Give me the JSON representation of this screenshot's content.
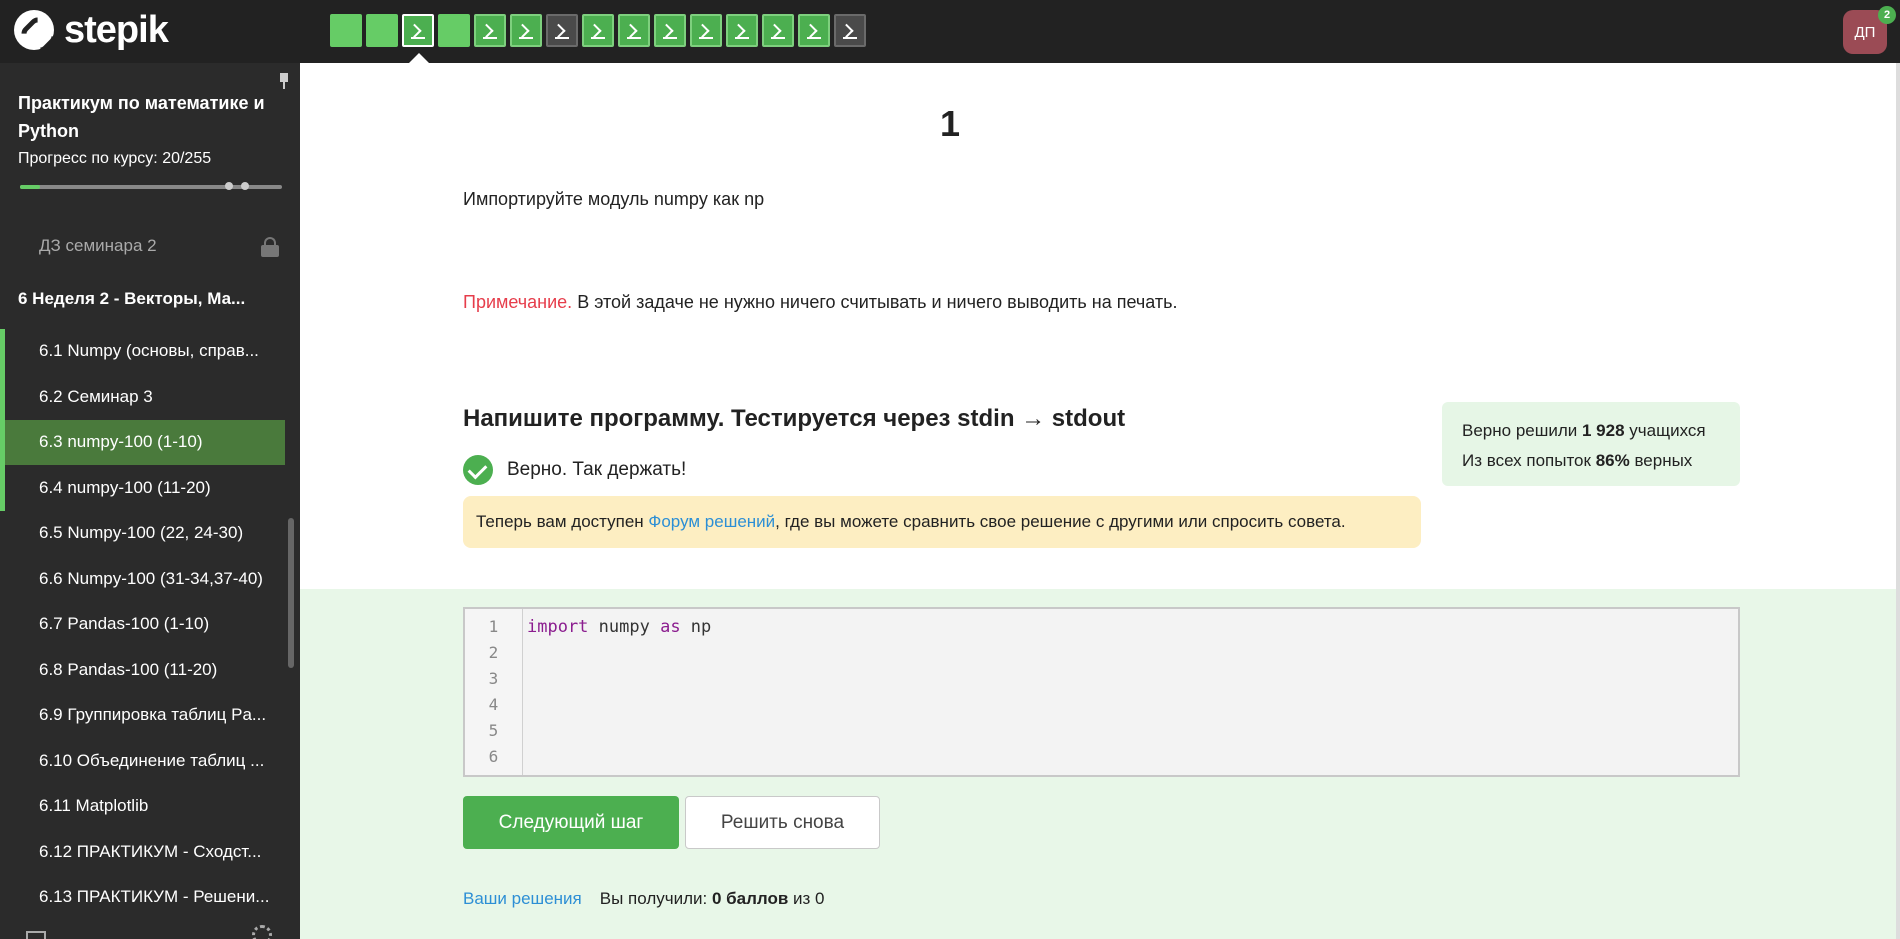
{
  "brand": {
    "name": "stepik"
  },
  "steps": [
    {
      "kind": "text",
      "state": "solved"
    },
    {
      "kind": "text",
      "state": "solved"
    },
    {
      "kind": "code",
      "state": "current"
    },
    {
      "kind": "text",
      "state": "solved"
    },
    {
      "kind": "code",
      "state": "solved"
    },
    {
      "kind": "code",
      "state": "solved"
    },
    {
      "kind": "code",
      "state": "unsolved"
    },
    {
      "kind": "code",
      "state": "solved"
    },
    {
      "kind": "code",
      "state": "solved"
    },
    {
      "kind": "code",
      "state": "solved"
    },
    {
      "kind": "code",
      "state": "solved"
    },
    {
      "kind": "code",
      "state": "solved"
    },
    {
      "kind": "code",
      "state": "solved"
    },
    {
      "kind": "code",
      "state": "solved"
    },
    {
      "kind": "code",
      "state": "unsolved"
    }
  ],
  "user": {
    "initials": "ДП",
    "badge": "2"
  },
  "sidebar": {
    "course_title": "Практикум по математике и Python",
    "progress_label": "Прогресс по курсу:",
    "progress_value": "20/255",
    "progress_fraction": 0.078,
    "items": [
      {
        "label": "ДЗ семинара 2",
        "type": "locked"
      },
      {
        "label": "6  Неделя 2 - Векторы, Ма...",
        "type": "section"
      },
      {
        "label": "6.1  Numpy (основы, справ...",
        "type": "done"
      },
      {
        "label": "6.2  Семинар 3",
        "type": "done"
      },
      {
        "label": "6.3  numpy-100 (1-10)",
        "type": "active"
      },
      {
        "label": "6.4  numpy-100 (11-20)",
        "type": "done"
      },
      {
        "label": "6.5  Numpy-100 (22, 24-30)",
        "type": "plain"
      },
      {
        "label": "6.6  Numpy-100 (31-34,37-40)",
        "type": "plain"
      },
      {
        "label": "6.7  Pandas-100 (1-10)",
        "type": "plain"
      },
      {
        "label": "6.8  Pandas-100 (11-20)",
        "type": "plain"
      },
      {
        "label": "6.9  Группировка таблиц Pa...",
        "type": "plain"
      },
      {
        "label": "6.10  Объединение таблиц ...",
        "type": "plain"
      },
      {
        "label": "6.11  Matplotlib",
        "type": "plain"
      },
      {
        "label": "6.12  ПРАКТИКУМ - Сходст...",
        "type": "plain"
      },
      {
        "label": "6.13  ПРАКТИКУМ - Решени...",
        "type": "plain"
      }
    ]
  },
  "main": {
    "step_title": "1",
    "task_text": "Импортируйте модуль numpy как np",
    "note_label": "Примечание.",
    "note_text": " В этой задаче не нужно ничего считывать и ничего выводить на печать.",
    "section_heading": "Напишите программу. Тестируется через stdin → stdout",
    "correct_text": "Верно. Так держать!",
    "forum_prefix": "Теперь вам доступен ",
    "forum_link": "Форум решений",
    "forum_suffix": " , где вы можете сравнить свое решение с другими или спросить совета.",
    "stats": {
      "solved_prefix": "Верно решили ",
      "solved_count": "1 928",
      "solved_suffix": " учащихся",
      "attempts_prefix": "Из всех попыток ",
      "attempts_percent": "86%",
      "attempts_suffix": " верных"
    },
    "editor": {
      "line_numbers": [
        "1",
        "2",
        "3",
        "4",
        "5",
        "6"
      ],
      "code_kw1": "import",
      "code_mid": " numpy ",
      "code_kw2": "as",
      "code_end": " np"
    },
    "next_button": "Следующий шаг",
    "retry_button": "Решить снова",
    "your_solutions": "Ваши решения",
    "score_prefix": "Вы получили: ",
    "score_value": "0 баллов",
    "score_suffix": " из 0"
  }
}
